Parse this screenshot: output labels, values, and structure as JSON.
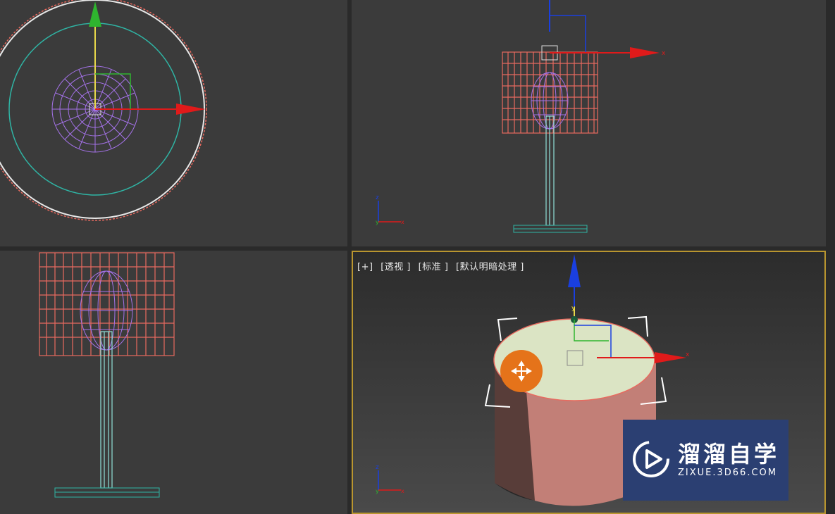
{
  "viewports": {
    "perspective": {
      "label_plus": "[+]",
      "label_view": "[透视 ]",
      "label_shading_std": "[标准 ]",
      "label_shading": "[默认明暗处理 ]"
    }
  },
  "axes": {
    "x": "x",
    "y": "y",
    "z": "z"
  },
  "watermark": {
    "brand_cn": "溜溜自学",
    "brand_url": "ZIXUE.3D66.COM"
  },
  "colors": {
    "shade": "#e86a5f",
    "bulb": "#a472e8",
    "stand": "#8fe0d8",
    "viewport_active_border": "#b9952f",
    "axis_x": "#e01a1a",
    "axis_y": "#2fb52f",
    "axis_z": "#1a3fe0"
  },
  "icons": {
    "move_cursor": "move-cursor-icon"
  }
}
